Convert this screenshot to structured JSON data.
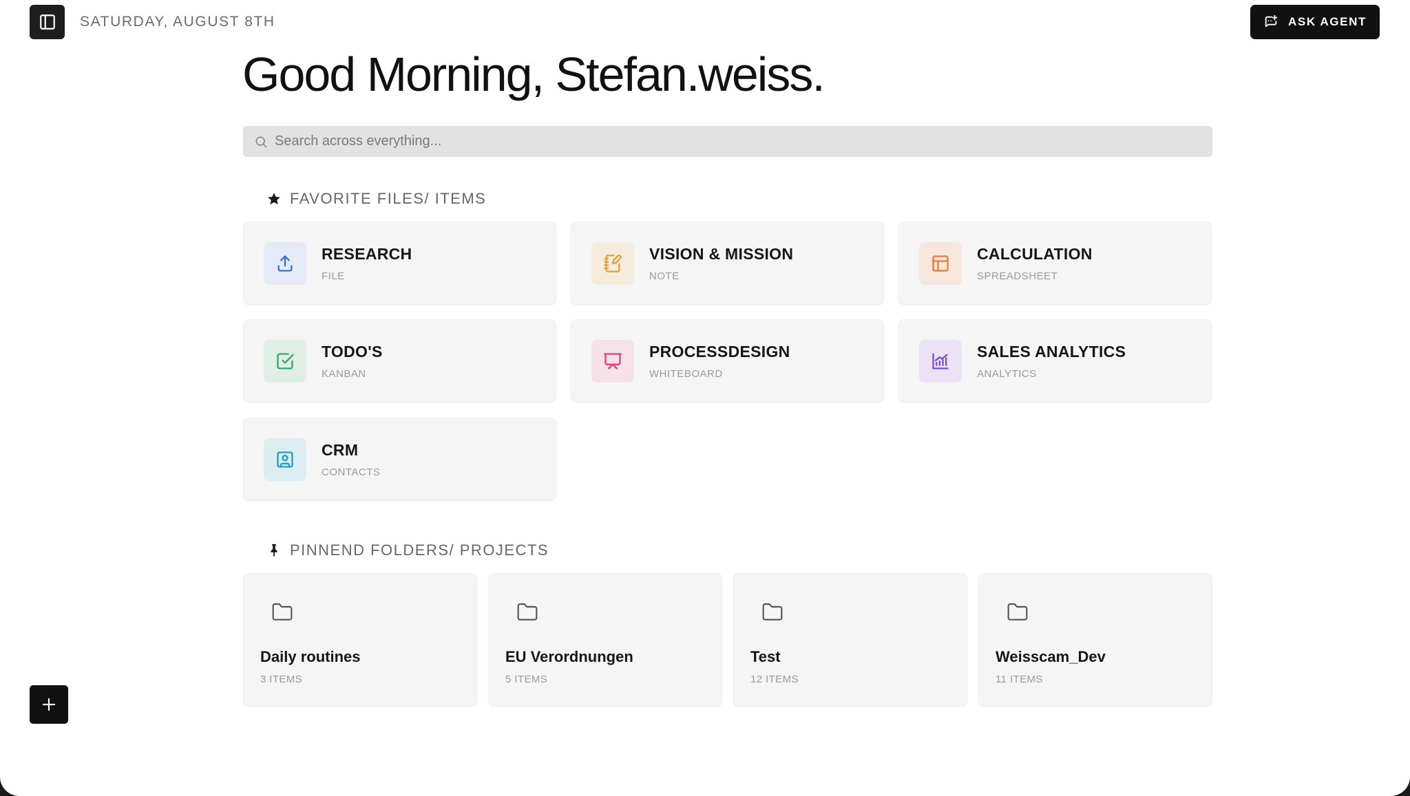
{
  "header": {
    "date": "SATURDAY, AUGUST 8TH",
    "ask_agent_label": "ASK AGENT"
  },
  "greeting": "Good Morning, Stefan.weiss.",
  "search": {
    "placeholder": "Search across everything..."
  },
  "favorites": {
    "title": "FAVORITE FILES/ ITEMS",
    "items": [
      {
        "title": "RESEARCH",
        "type": "FILE",
        "icon": "upload-icon",
        "color": "#3b6fd4",
        "bg": "#e4eaf6"
      },
      {
        "title": "VISION & MISSION",
        "type": "NOTE",
        "icon": "notebook-pen-icon",
        "color": "#e0a23a",
        "bg": "#f6ecdd"
      },
      {
        "title": "CALCULATION",
        "type": "SPREADSHEET",
        "icon": "table-icon",
        "color": "#e47a3a",
        "bg": "#f6e6dc"
      },
      {
        "title": "TODO'S",
        "type": "KANBAN",
        "icon": "checkbox-icon",
        "color": "#2fa86d",
        "bg": "#e0efe6"
      },
      {
        "title": "PROCESSDESIGN",
        "type": "WHITEBOARD",
        "icon": "presentation-icon",
        "color": "#e03c7a",
        "bg": "#f5e1e8"
      },
      {
        "title": "SALES ANALYTICS",
        "type": "ANALYTICS",
        "icon": "chart-icon",
        "color": "#7b4fd0",
        "bg": "#ebe3f5"
      },
      {
        "title": "CRM",
        "type": "CONTACTS",
        "icon": "contact-icon",
        "color": "#1e9fc2",
        "bg": "#dcedf2"
      }
    ]
  },
  "pinned": {
    "title": "PINNEND FOLDERS/ PROJECTS",
    "folders": [
      {
        "name": "Daily routines",
        "count": "3 ITEMS"
      },
      {
        "name": "EU Verordnungen",
        "count": "5 ITEMS"
      },
      {
        "name": "Test",
        "count": "12 ITEMS"
      },
      {
        "name": "Weisscam_Dev",
        "count": "11 ITEMS"
      }
    ]
  }
}
